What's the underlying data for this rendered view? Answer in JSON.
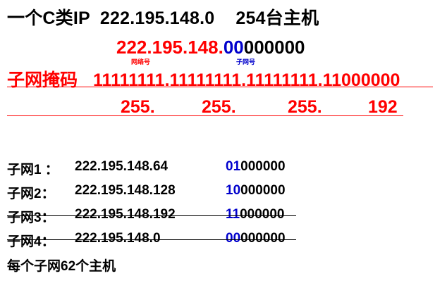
{
  "title": {
    "prefix": "一个C类IP",
    "ip": "222.195.148.0",
    "hosts": "254台主机"
  },
  "ip_line": {
    "network": "222.195.148.",
    "subnet_bits": "00",
    "host_bits": "000000",
    "network_label": "网络号",
    "subnet_label": "子网号"
  },
  "mask": {
    "label": "子网掩码",
    "bits": "11111111.11111111.11111111.11000000",
    "decimal": [
      "255.",
      "255.",
      "255.",
      "192"
    ]
  },
  "subnets": [
    {
      "name": "子网1 ：",
      "addr": "222.195.148.64",
      "subnet_bits": "01",
      "host_bits": "000000",
      "struck": false
    },
    {
      "name": "子网2：",
      "addr": "222.195.148.128",
      "subnet_bits": "10",
      "host_bits": "000000",
      "struck": false
    },
    {
      "name": "子网3：",
      "addr": "222.195.148.192",
      "subnet_bits": "11",
      "host_bits": "000000",
      "struck": true
    },
    {
      "name": "子网4：",
      "addr": "222.195.148.0",
      "subnet_bits": "00",
      "host_bits": "000000",
      "struck": true
    }
  ],
  "footer": "每个子网62个主机",
  "colors": {
    "red": "#ff0000",
    "blue": "#0000cc",
    "black": "#000000"
  }
}
